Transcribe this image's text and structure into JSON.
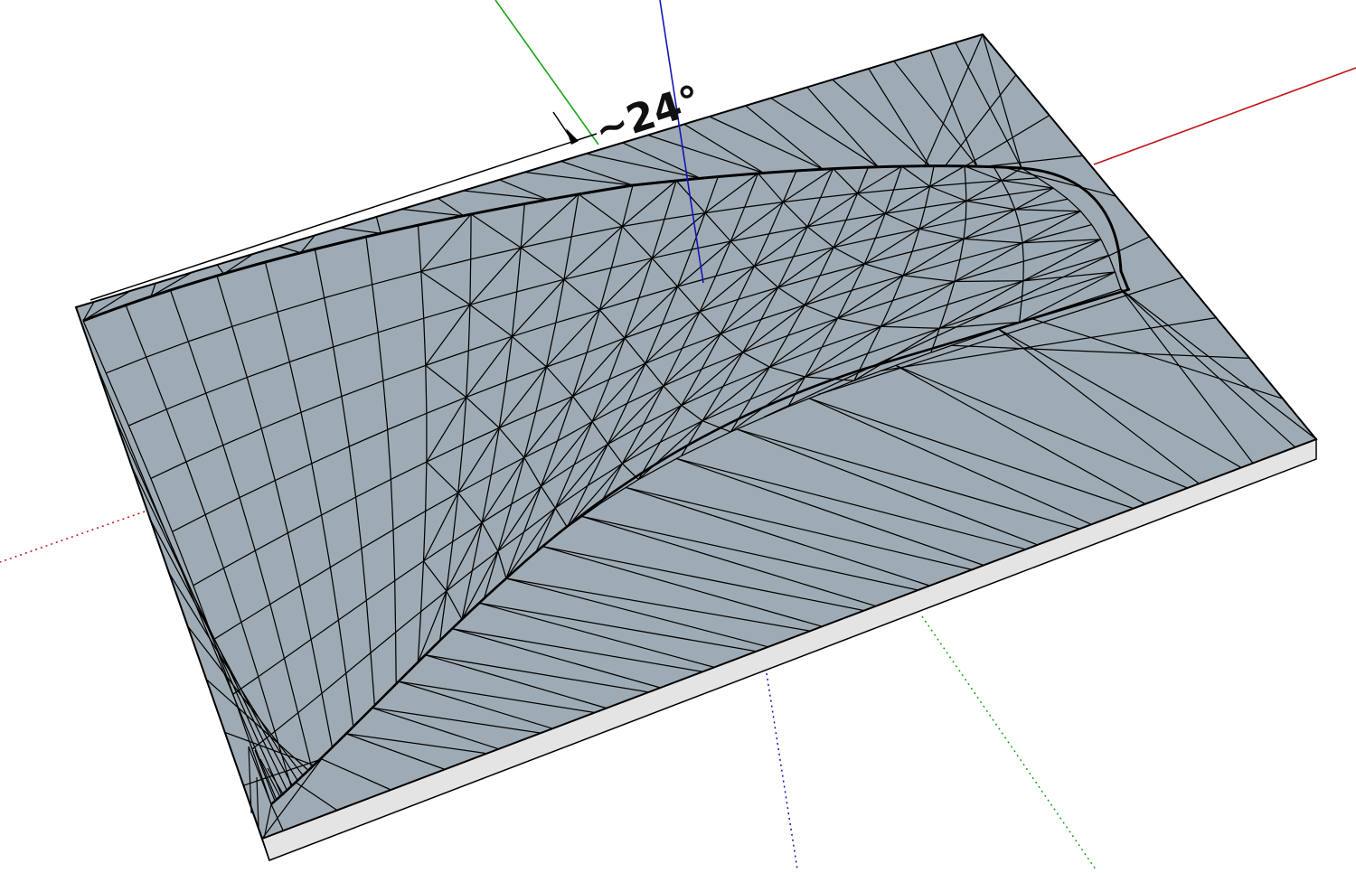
{
  "viewport": {
    "background": "#ffffff",
    "face_color": "#9fabb4",
    "side_color": "#e4e4e4",
    "edge_color": "#000000"
  },
  "axes": {
    "red": "#c0151a",
    "green": "#1aa51a",
    "blue": "#1515b8"
  },
  "dimension": {
    "label": "~24°"
  }
}
